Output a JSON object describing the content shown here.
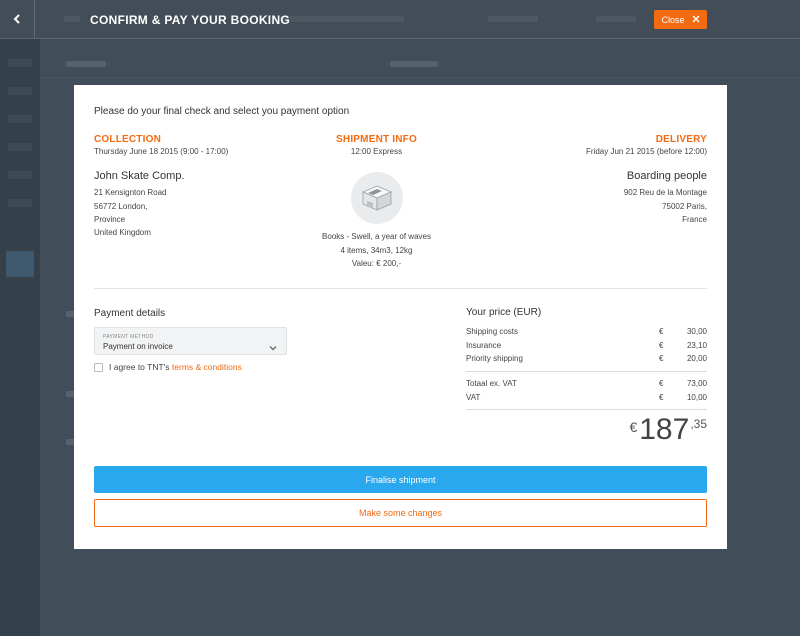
{
  "header": {
    "title": "CONFIRM & PAY YOUR BOOKING",
    "close_label": "Close"
  },
  "modal": {
    "intro": "Please do your final check and select you payment option",
    "collection": {
      "title": "COLLECTION",
      "date": "Thursday June 18 2015 (9:00 - 17:00)",
      "name": "John Skate Comp.",
      "address": [
        "21 Kensignton Road",
        "56772 London,",
        "Province",
        "United Kingdom"
      ]
    },
    "shipment": {
      "title": "SHIPMENT INFO",
      "service": "12:00 Express",
      "details": [
        "Books - Swell, a year of waves",
        "4 items, 34m3, 12kg",
        "Valeu: € 200,-"
      ]
    },
    "delivery": {
      "title": "DELIVERY",
      "date": "Friday Jun 21 2015 (before 12:00)",
      "name": "Boarding people",
      "address": [
        "902 Reu de la Montage",
        "75002 Paris,",
        "France"
      ]
    },
    "payment": {
      "title": "Payment details",
      "method_label": "PAYMENT METHOD",
      "method_value": "Payment on invoice",
      "agree_text": "I agree to TNT's",
      "terms_link": "terms & conditions"
    },
    "price": {
      "title": "Your price (EUR)",
      "currency_symbol": "€",
      "lines": [
        {
          "label": "Shipping costs",
          "amount": "30,00"
        },
        {
          "label": "Insurance",
          "amount": "23,10"
        },
        {
          "label": "Priority shipping",
          "amount": "20,00"
        }
      ],
      "subtotals": [
        {
          "label": "Totaal ex. VAT",
          "amount": "73,00"
        },
        {
          "label": "VAT",
          "amount": "10,00"
        }
      ],
      "total_integer": "187",
      "total_decimal": ",35"
    },
    "buttons": {
      "finalise": "Finalise shipment",
      "changes": "Make some changes"
    }
  },
  "colors": {
    "accent_orange": "#f26a11",
    "primary_blue": "#2aa8ee",
    "overlay": "#3d4852"
  }
}
